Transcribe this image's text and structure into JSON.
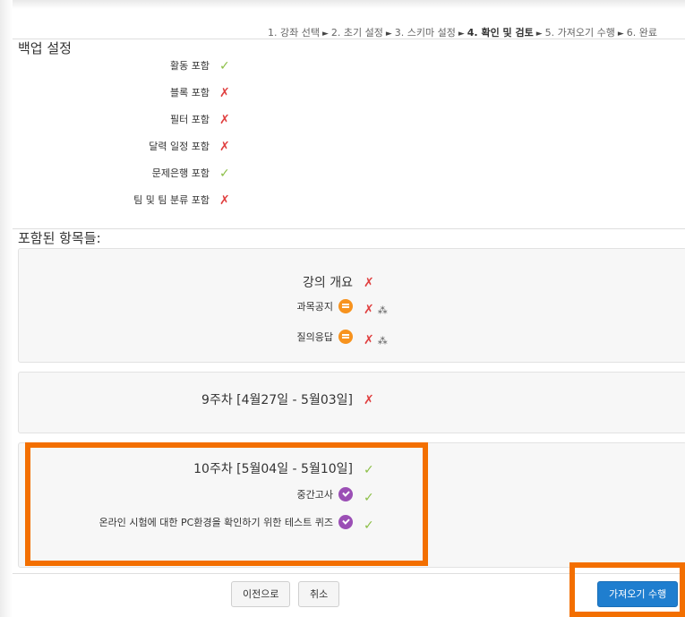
{
  "breadcrumb": [
    {
      "label": "1. 강좌 선택",
      "active": false
    },
    {
      "label": "2. 초기 설정",
      "active": false
    },
    {
      "label": "3. 스키마 설정",
      "active": false
    },
    {
      "label": "4. 확인 및 검토",
      "active": true
    },
    {
      "label": "5. 가져오기 수행",
      "active": false
    },
    {
      "label": "6. 완료",
      "active": false
    }
  ],
  "breadcrumb_separator": "►",
  "backup_settings": {
    "title": "백업 설정",
    "items": [
      {
        "label": "활동 포함",
        "included": true
      },
      {
        "label": "블록 포함",
        "included": false
      },
      {
        "label": "필터 포함",
        "included": false
      },
      {
        "label": "달력 일정 포함",
        "included": false
      },
      {
        "label": "문제은행 포함",
        "included": true
      },
      {
        "label": "팀 및 팀 분류 포함",
        "included": false
      }
    ]
  },
  "included_items": {
    "title": "포함된 항목들:",
    "sections": [
      {
        "name": "강의 개요",
        "included": false,
        "modules": [
          {
            "name": "과목공지",
            "icon": "forum-icon",
            "included": false,
            "user_data_warning": true
          },
          {
            "name": "질의응답",
            "icon": "forum-icon",
            "included": false,
            "user_data_warning": true
          }
        ]
      },
      {
        "name": "9주차 [4월27일 - 5월03일]",
        "included": false,
        "modules": []
      },
      {
        "name": "10주차 [5월04일 - 5월10일]",
        "included": true,
        "modules": [
          {
            "name": "중간고사",
            "icon": "quiz-icon",
            "included": true,
            "user_data_warning": false
          },
          {
            "name": "온라인 시험에 대한 PC환경을 확인하기 위한 테스트 퀴즈",
            "icon": "quiz-icon",
            "included": true,
            "user_data_warning": false
          }
        ]
      }
    ]
  },
  "symbols": {
    "yes": "✓",
    "no": "✗",
    "warning": "⁂"
  },
  "buttons": {
    "previous": "이전으로",
    "cancel": "취소",
    "perform_import": "가져오기 수행"
  },
  "colors": {
    "yes": "#8cbf47",
    "no": "#e04040",
    "highlight": "#f36f00",
    "primary": "#1f7ecf",
    "forum_icon": "#f7931e",
    "quiz_icon": "#9b4fb5"
  }
}
